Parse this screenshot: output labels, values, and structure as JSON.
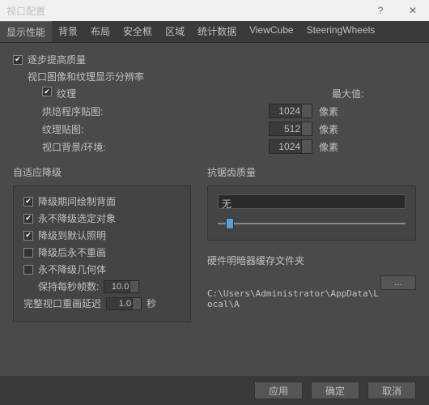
{
  "window": {
    "title": "视口配置"
  },
  "tabs": [
    "显示性能",
    "背景",
    "布局",
    "安全框",
    "区域",
    "统计数据",
    "ViewCube",
    "SteeringWheels"
  ],
  "active_tab": 0,
  "progressive": {
    "checkbox_label": "逐步提高质量",
    "subtitle": "视口图像和纹理显示分辨率",
    "texture_label": "纹理",
    "max_label": "最大值:",
    "rows": [
      {
        "label": "烘焙程序贴图:",
        "value": "1024",
        "unit": "像素"
      },
      {
        "label": "纹理贴图:",
        "value": "512",
        "unit": "像素"
      },
      {
        "label": "视口背景/环境:",
        "value": "1024",
        "unit": "像素"
      }
    ]
  },
  "adaptive": {
    "title": "自适应降级",
    "items": [
      {
        "label": "降级期间绘制背面",
        "checked": true
      },
      {
        "label": "永不降级选定对象",
        "checked": true
      },
      {
        "label": "降级到默认照明",
        "checked": true
      },
      {
        "label": "降级后永不重画",
        "checked": false
      },
      {
        "label": "永不降级几何体",
        "checked": false
      }
    ],
    "fps_label": "保持每秒帧数:",
    "fps_value": "10.0",
    "delay_label": "完整视口重画延迟",
    "delay_value": "1.0",
    "delay_unit": "秒"
  },
  "antialias": {
    "title": "抗锯齿质量",
    "value": "无"
  },
  "hardware": {
    "title": "硬件明暗器缓存文件夹",
    "browse": "...",
    "path": "C:\\Users\\Administrator\\AppData\\Local\\A"
  },
  "footer": {
    "apply": "应用",
    "ok": "确定",
    "cancel": "取消"
  }
}
